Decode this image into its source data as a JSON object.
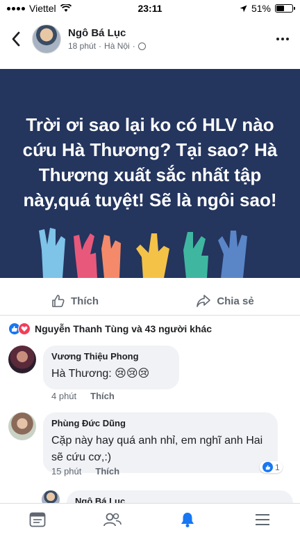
{
  "status_bar": {
    "carrier": "Viettel",
    "time": "23:11",
    "battery": "51%",
    "battery_level": 0.51
  },
  "header": {
    "name": "Ngô Bá Lục",
    "time_ago": "18 phút",
    "separator": "·",
    "location": "Hà Nội",
    "separator2": "·"
  },
  "post": {
    "text": "Trời ơi sao lại ko có HLV nào cứu Hà Thương? Tại sao? Hà Thương xuất sắc nhất tập này,quá tuyệt! Sẽ là ngôi sao!",
    "background_color": "#24355e"
  },
  "actions": {
    "like_label": "Thích",
    "share_label": "Chia sẻ"
  },
  "reactions": {
    "summary": "Nguyễn Thanh Tùng và 43 người khác"
  },
  "comments": [
    {
      "name": "Vương Thiệu Phong",
      "text": "Hà Thương: 😢😢😢",
      "time": "4 phút",
      "like_label": "Thích"
    },
    {
      "name": "Phùng Đức Dũng",
      "text": "Cặp này hay quá anh nhỉ, em nghĩ anh Hai sẽ cứu cơ,:)",
      "time": "15 phút",
      "like_label": "Thích",
      "likes": "1"
    },
    {
      "name": "Ngô Bá Lục"
    }
  ],
  "colors": {
    "brand_blue": "#1877f2",
    "love_red": "#f33e58",
    "text_secondary": "#606770"
  },
  "bottom_nav": {
    "icons": [
      "news-feed-icon",
      "friends-icon",
      "notifications-icon",
      "menu-icon"
    ],
    "active": "notifications-icon"
  }
}
